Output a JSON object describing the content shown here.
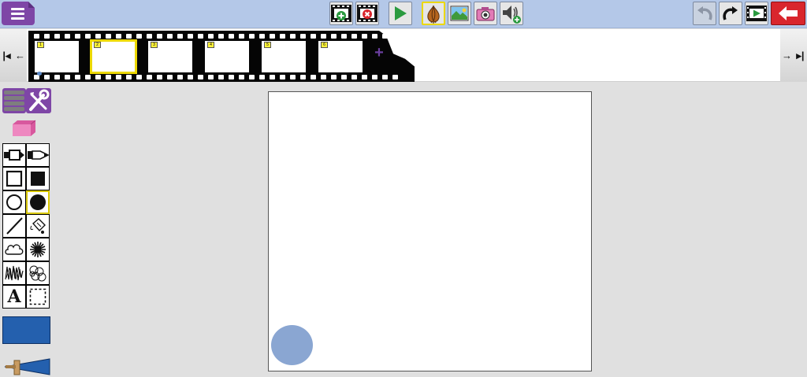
{
  "colors": {
    "toolbar_bg": "#b4c8e8",
    "menu_purple": "#7e46a6",
    "selection_yellow": "#ecd800",
    "current_color": "#2460ae",
    "exit_red": "#d9262d",
    "play_green": "#2a9a3f"
  },
  "toolbar": {
    "left": [
      {
        "icon": "menu-icon"
      }
    ],
    "center": [
      {
        "icon": "add-frame-icon"
      },
      {
        "icon": "delete-frame-icon"
      },
      {
        "icon": "play-icon"
      },
      {
        "icon": "onion-skin-icon",
        "selected": true
      },
      {
        "icon": "background-image-icon"
      },
      {
        "icon": "camera-icon"
      },
      {
        "icon": "add-sound-icon"
      }
    ],
    "right": [
      {
        "icon": "undo-icon",
        "enabled": false
      },
      {
        "icon": "redo-icon",
        "enabled": true
      },
      {
        "icon": "preview-movie-icon"
      },
      {
        "icon": "exit-icon"
      }
    ]
  },
  "filmstrip": {
    "frames": [
      {
        "number": "1",
        "selected": false,
        "has_content": true
      },
      {
        "number": "2",
        "selected": true,
        "has_content": false
      },
      {
        "number": "3",
        "selected": false,
        "has_content": false
      },
      {
        "number": "4",
        "selected": false,
        "has_content": false
      },
      {
        "number": "5",
        "selected": false,
        "has_content": false
      },
      {
        "number": "6",
        "selected": false,
        "has_content": false
      }
    ],
    "add_label": "+"
  },
  "tools": {
    "rows": [
      [
        "marker-icon",
        "pencil-icon"
      ],
      [
        "rectangle-outline-icon",
        "rectangle-filled-icon"
      ],
      [
        "circle-outline-icon",
        "circle-filled-icon"
      ],
      [
        "line-icon",
        "fill-bucket-icon"
      ],
      [
        "cloud-brush-icon",
        "splatter-brush-icon"
      ],
      [
        "scribble-brush-icon",
        "circles-stamp-icon"
      ],
      [
        "text-icon",
        "select-area-icon"
      ]
    ],
    "active": "circle-filled-icon",
    "text_tool_label": "A"
  }
}
